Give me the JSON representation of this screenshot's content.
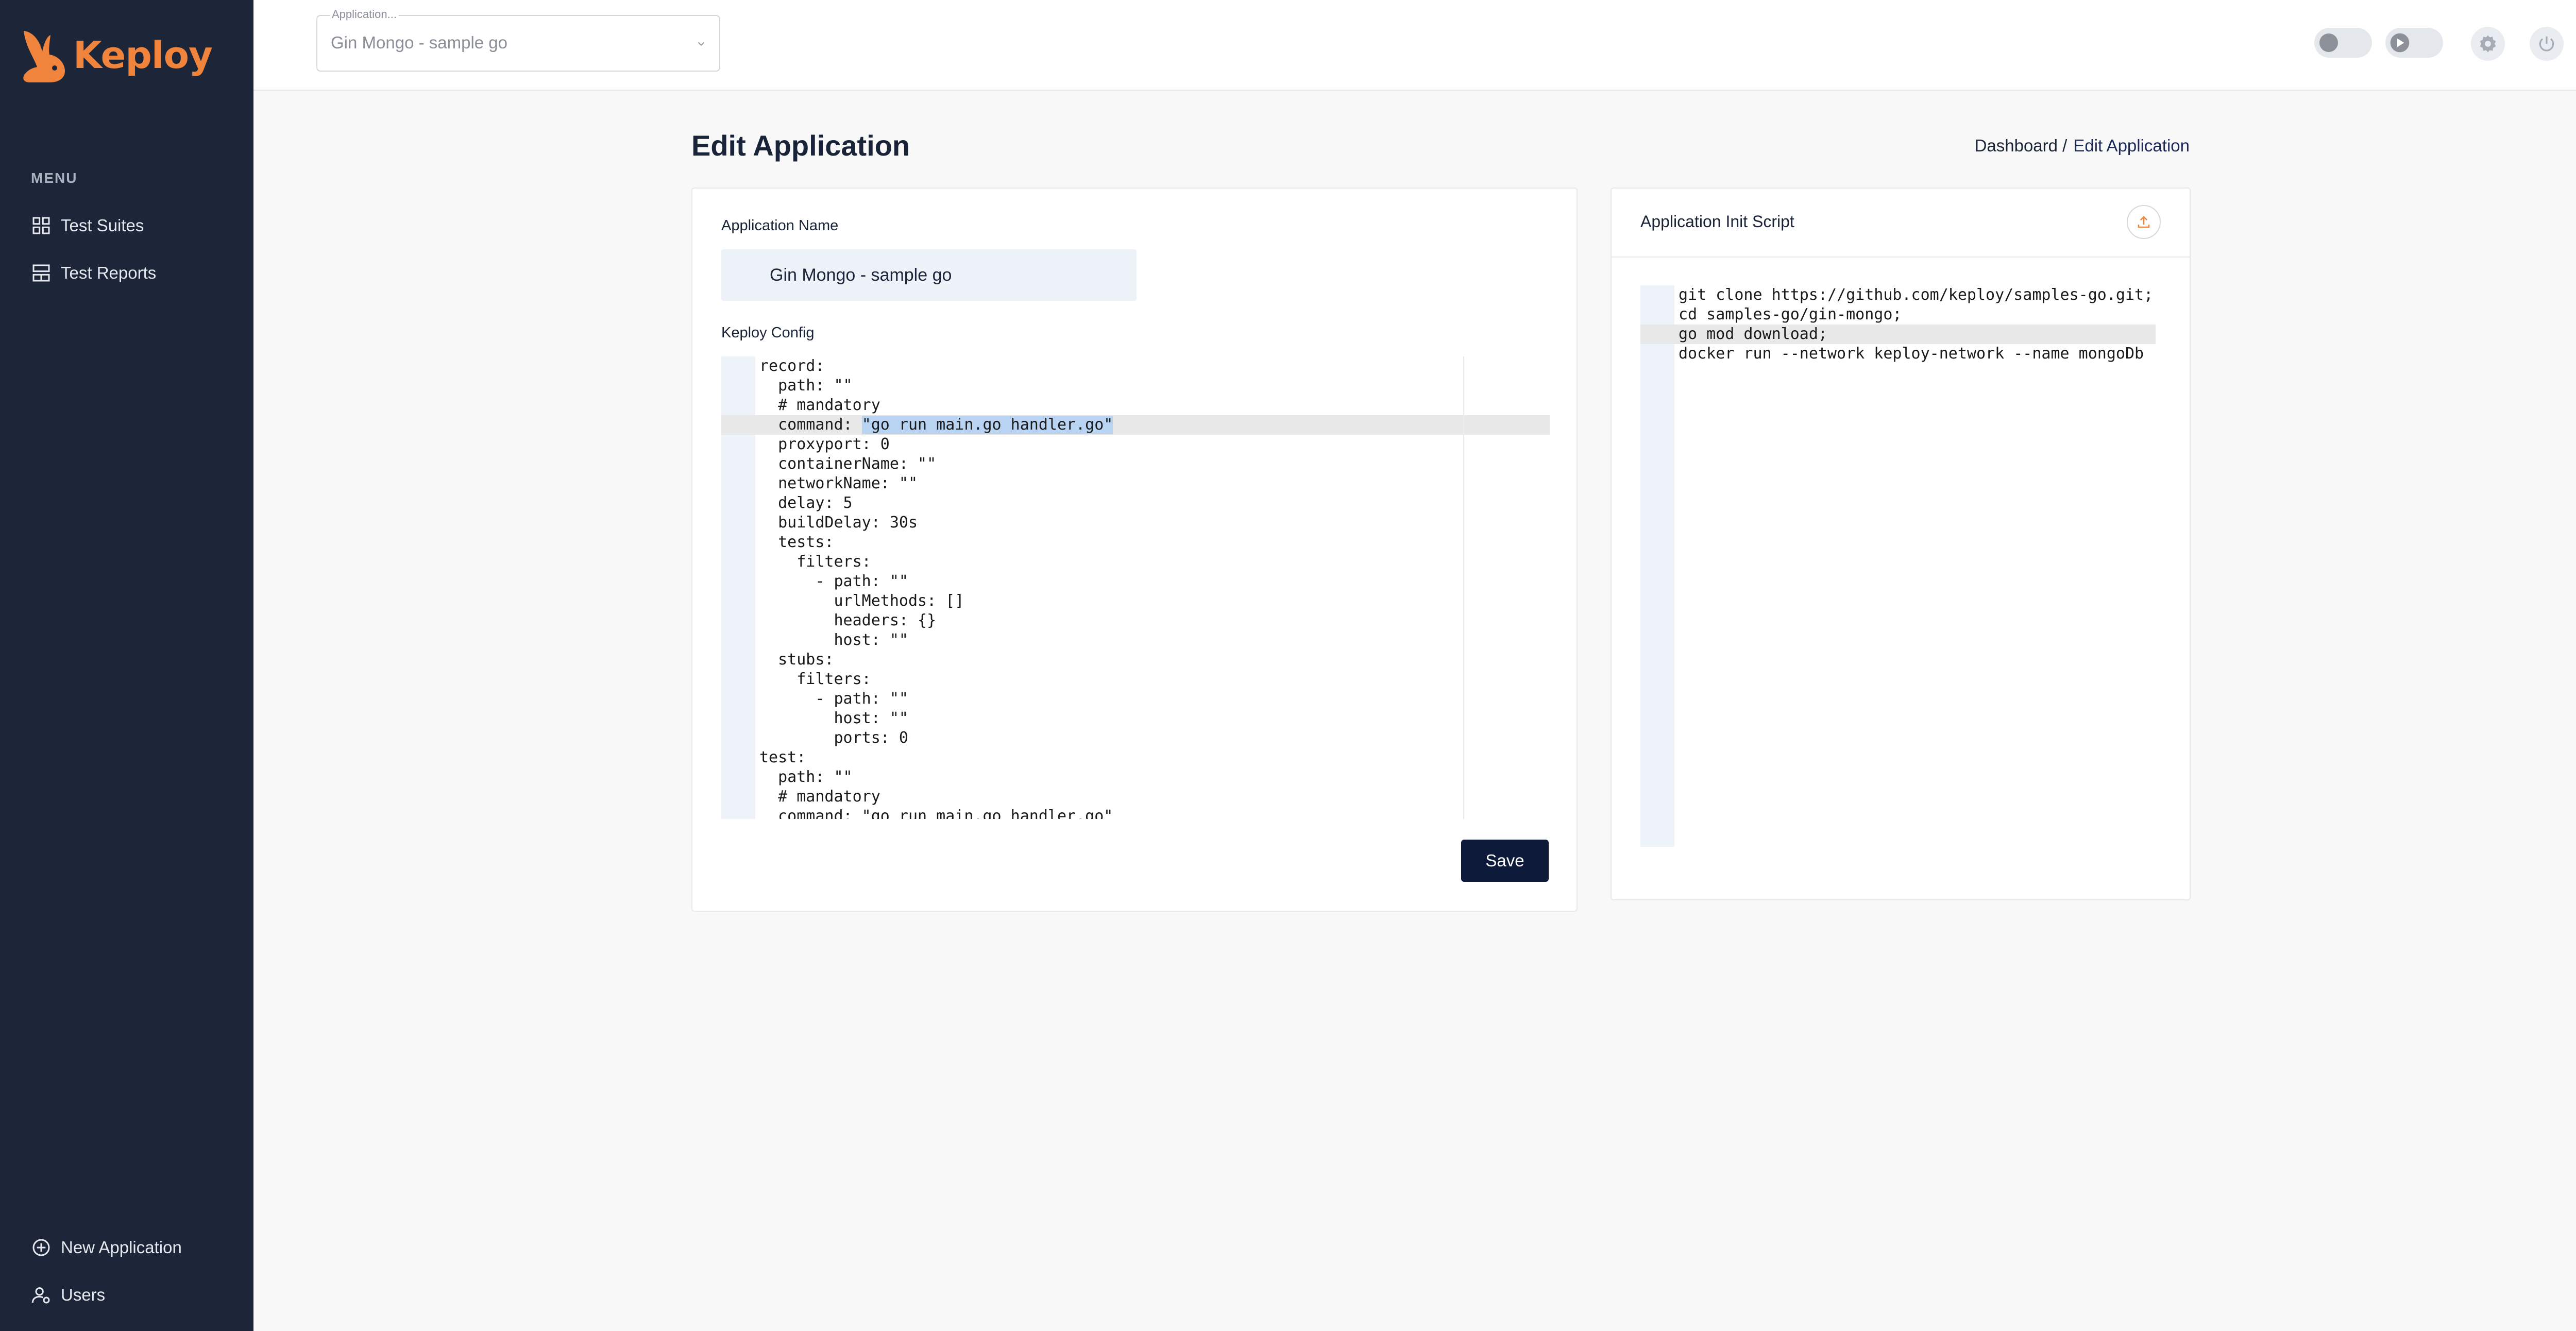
{
  "app": {
    "logo_text": "Keploy",
    "brand_color": "#f0843c"
  },
  "sidebar": {
    "menu_title": "MENU",
    "items": [
      {
        "label": "Test Suites",
        "icon": "grid-icon"
      },
      {
        "label": "Test Reports",
        "icon": "reports-icon"
      }
    ],
    "bottom_items": [
      {
        "label": "New Application",
        "icon": "plus-circle-icon"
      },
      {
        "label": "Users",
        "icon": "user-gear-icon"
      }
    ]
  },
  "topbar": {
    "app_select": {
      "label": "Application...",
      "value": "Gin Mongo - sample go"
    }
  },
  "page": {
    "title": "Edit Application",
    "breadcrumb": [
      "Dashboard /",
      "Edit Application"
    ]
  },
  "form": {
    "name_label": "Application Name",
    "name_value": "Gin Mongo - sample go",
    "config_label": "Keploy Config",
    "save_label": "Save",
    "config_lines": [
      "record:",
      "  path: \"\"",
      "  # mandatory",
      "  command: ",
      "  proxyport: 0",
      "  containerName: \"\"",
      "  networkName: \"\"",
      "  delay: 5",
      "  buildDelay: 30s",
      "  tests:",
      "    filters:",
      "      - path: \"\"",
      "        urlMethods: []",
      "        headers: {}",
      "        host: \"\"",
      "  stubs:",
      "    filters:",
      "      - path: \"\"",
      "        host: \"\"",
      "        ports: 0",
      "test:",
      "  path: \"\"",
      "  # mandatory",
      "  command: \"go run main.go handler.go\""
    ],
    "highlight_text": "\"go run main.go handler.go\""
  },
  "init_script": {
    "title": "Application Init Script",
    "lines": [
      "git clone https://github.com/keploy/samples-go.git;",
      "cd samples-go/gin-mongo;",
      "go mod download;",
      "docker run --network keploy-network --name mongoDb -d"
    ]
  }
}
